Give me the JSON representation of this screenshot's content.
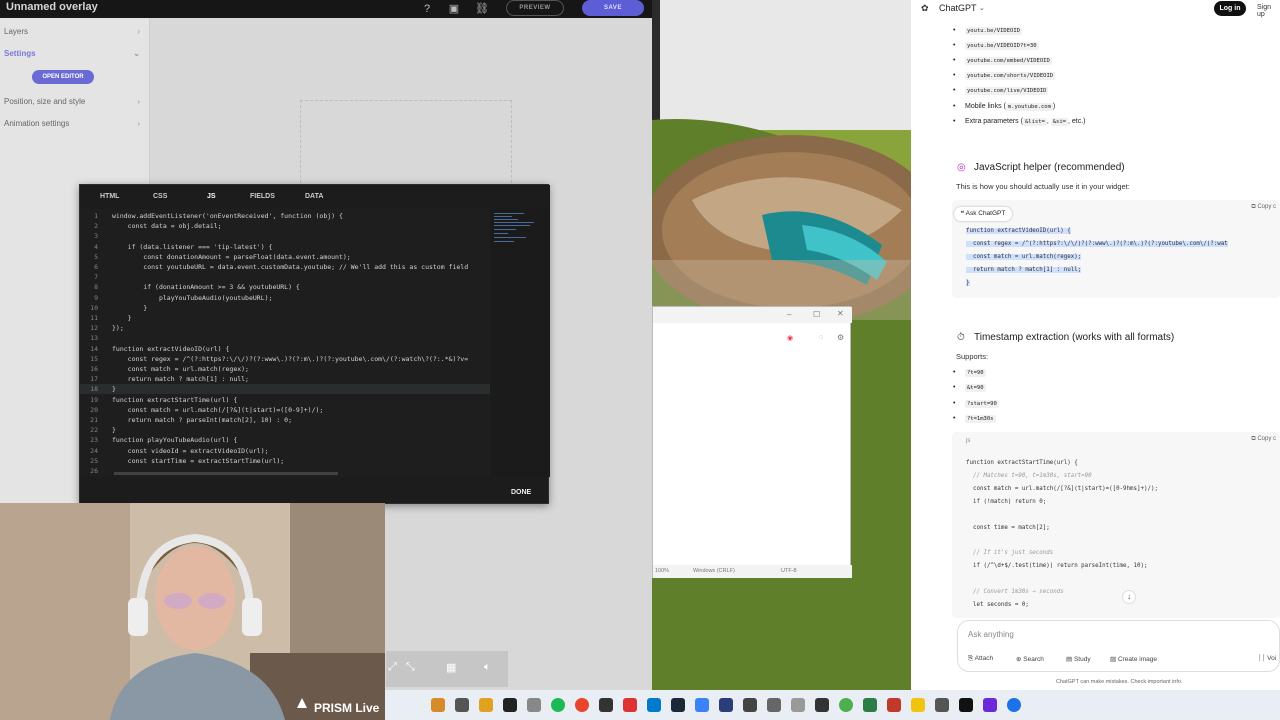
{
  "editor": {
    "title": "Unnamed overlay",
    "preview_label": "PREVIEW",
    "save_label": "SAVE",
    "sidebar": {
      "layers": "Layers",
      "settings": "Settings",
      "open_editor": "OPEN EDITOR",
      "position": "Position, size and style",
      "animation": "Animation settings"
    },
    "code_dialog": {
      "tabs": [
        "HTML",
        "CSS",
        "JS",
        "FIELDS",
        "DATA"
      ],
      "active_tab": "JS",
      "done_label": "DONE",
      "lines": [
        "window.addEventListener('onEventReceived', function (obj) {",
        "    const data = obj.detail;",
        "",
        "    if (data.listener === 'tip-latest') {",
        "        const donationAmount = parseFloat(data.event.amount);",
        "        const youtubeURL = data.event.customData.youtube; // We'll add this as custom field",
        "",
        "        if (donationAmount >= 3 && youtubeURL) {",
        "            playYouTubeAudio(youtubeURL);",
        "        }",
        "    }",
        "});",
        "",
        "function extractVideoID(url) {",
        "    const regex = /^(?:https?:\\/\\/)?(?:www\\.)?(?:m\\.)?(?:youtube\\.com\\/(?:watch\\?(?:.*&)?v=",
        "    const match = url.match(regex);",
        "    return match ? match[1] : null;",
        "}",
        "function extractStartTime(url) {",
        "    const match = url.match(/[?&](t|start)=([0-9]+)/);",
        "    return match ? parseInt(match[2], 10) : 0;",
        "}",
        "function playYouTubeAudio(url) {",
        "    const videoId = extractVideoID(url);",
        "    const startTime = extractStartTime(url);",
        ""
      ]
    }
  },
  "webcam": {
    "brand": "PRISM Live"
  },
  "notepad": {
    "zoom": "100%",
    "line_ending": "Windows (CRLF)",
    "encoding": "UTF-8"
  },
  "chatgpt": {
    "title": "ChatGPT",
    "login_label": "Log in",
    "signup_label": "Sign up",
    "url_formats": [
      "youtu.be/VIDEOID",
      "youtu.be/VIDEOID?t=30",
      "youtube.com/embed/VIDEOID",
      "youtube.com/shorts/VIDEOID",
      "youtube.com/live/VIDEOID"
    ],
    "mobile_links_prefix": "Mobile links (",
    "mobile_links_chip": "m.youtube.com",
    "mobile_links_suffix": ")",
    "extra_params_prefix": "Extra parameters (",
    "extra_params_chip1": "&list=",
    "extra_params_chip2": "&si=",
    "extra_params_suffix": ", etc.)",
    "section1_title": "JavaScript helper (recommended)",
    "section1_text": "This is how you should actually use it in your widget:",
    "ask_chip": "Ask ChatGPT",
    "copy_label": "Copy c",
    "code1": [
      "function extractVideoID(url) {",
      "  const regex = /^(?:https?:\\/\\/)?(?:www\\.)?(?:m\\.)?(?:youtube\\.com\\/(?:wat",
      "  const match = url.match(regex);",
      "  return match ? match[1] : null;",
      "}"
    ],
    "section2_title": "Timestamp extraction (works with all formats)",
    "section2_text": "Supports:",
    "ts_formats": [
      "?t=90",
      "&t=90",
      "?start=90",
      "?t=1m30s"
    ],
    "lang_label": "js",
    "code2": [
      "function extractStartTime(url) {",
      "  // Matches t=90, t=1m30s, start=90",
      "  const match = url.match(/[?&](t|start)=([0-9hms]+)/);",
      "  if (!match) return 0;",
      "",
      "  const time = match[2];",
      "",
      "  // If it's just seconds",
      "  if (/^\\d+$/.test(time)) return parseInt(time, 10);",
      "",
      "  // Convert 1m30s → seconds",
      "  let seconds = 0;"
    ],
    "input_placeholder": "Ask anything",
    "tools": [
      "Attach",
      "Search",
      "Study",
      "Create image",
      "Voi"
    ],
    "footer": "ChatGPT can make mistakes. Check important info."
  },
  "colors": {
    "accent": "#5d5dd6",
    "code_bg": "#1e1e1e",
    "selection": "#cfe0ff"
  }
}
